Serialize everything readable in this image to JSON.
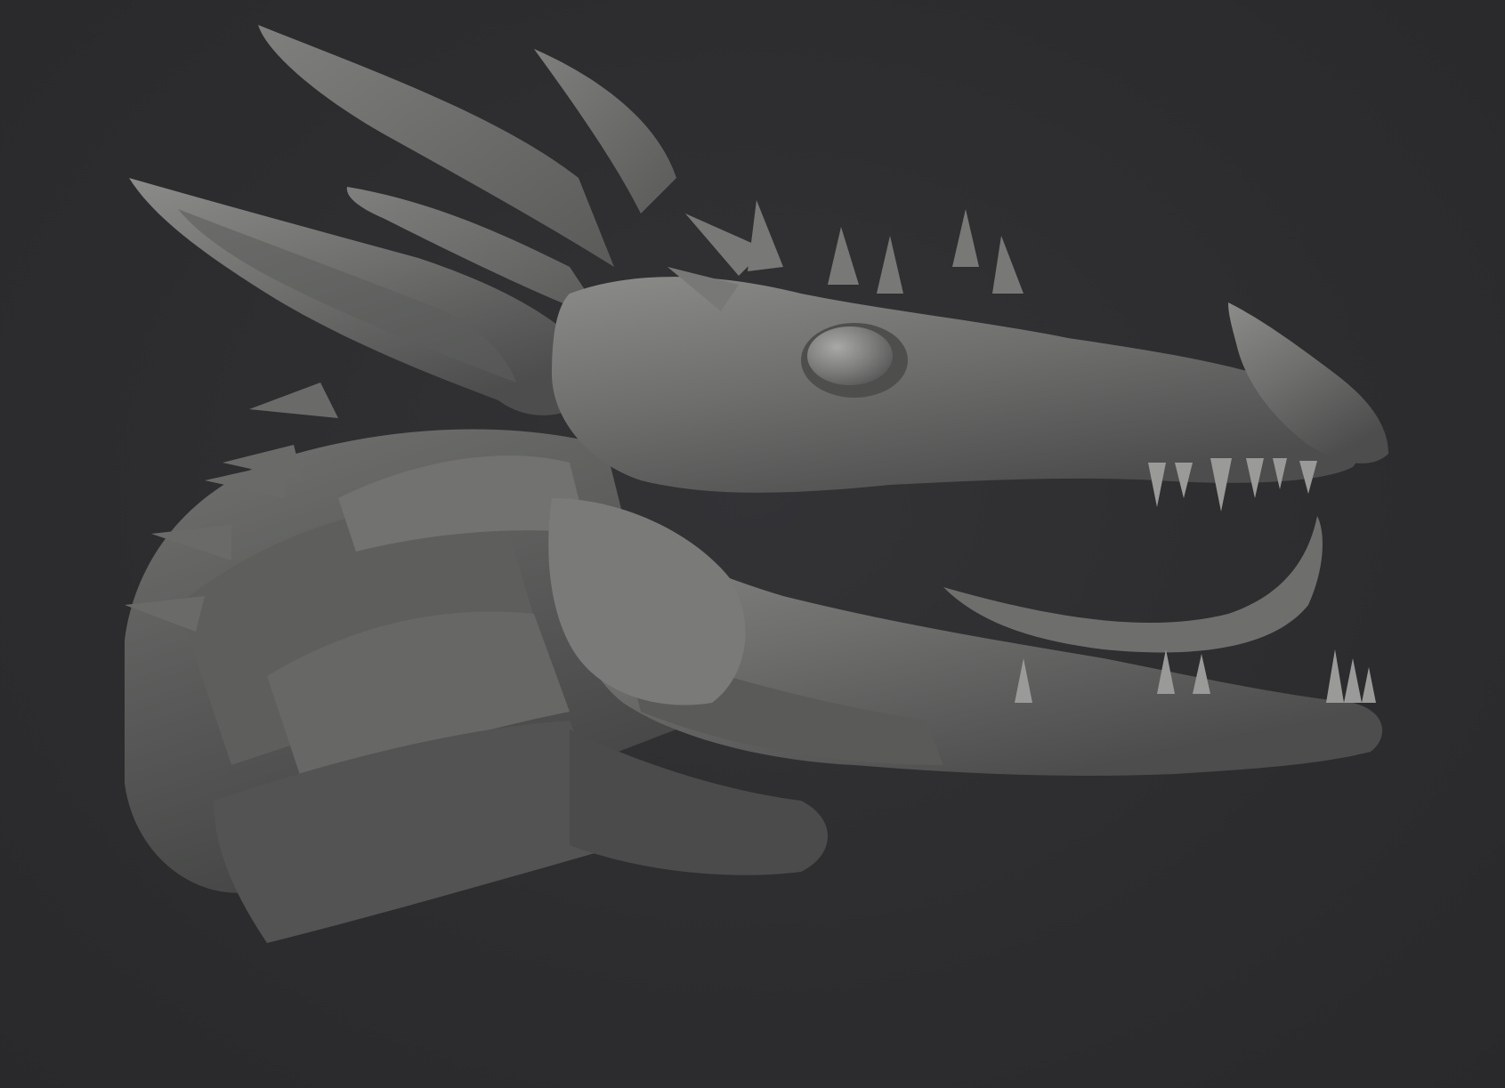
{
  "scene": {
    "subject_icon": "dragon-head-sculpt",
    "colors": {
      "background": "#2c2c2e",
      "clay_light": "#8a8b89",
      "clay_mid": "#6c6d6b",
      "clay_dark": "#4a4b4a",
      "clay_shadow": "#3a3b3a"
    }
  }
}
